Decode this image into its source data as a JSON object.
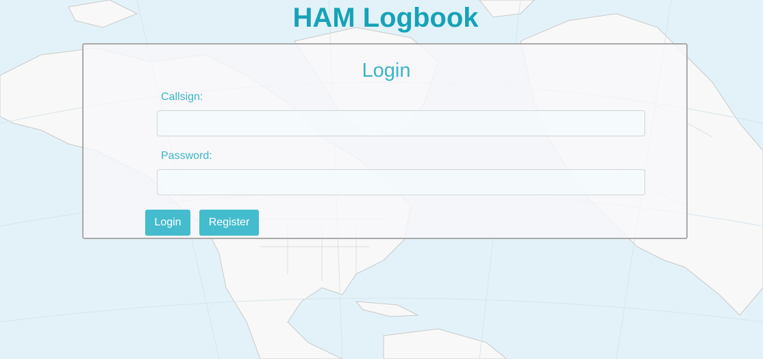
{
  "header": {
    "title": "HAM Logbook"
  },
  "login_form": {
    "title": "Login",
    "callsign_label": "Callsign:",
    "callsign_value": "",
    "password_label": "Password:",
    "password_value": "",
    "login_button": "Login",
    "register_button": "Register"
  },
  "colors": {
    "accent": "#17a2b8",
    "button": "#44bccd",
    "map_water": "#e3f2f9",
    "map_land": "#f8f8f8"
  }
}
